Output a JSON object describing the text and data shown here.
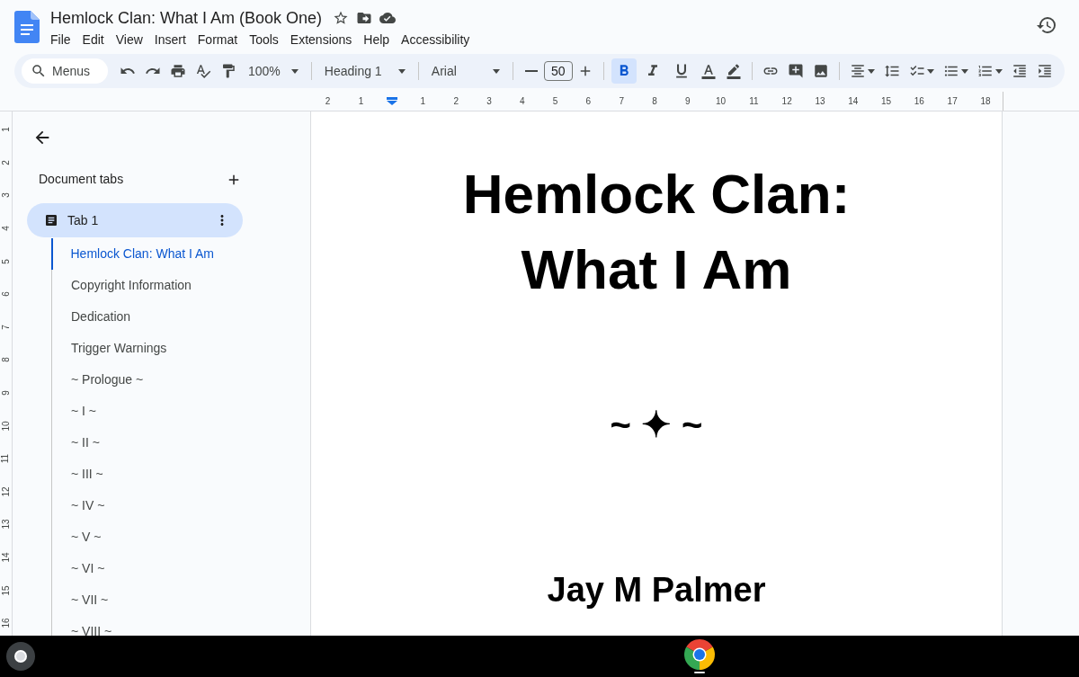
{
  "document": {
    "title": "Hemlock Clan: What I Am (Book One)"
  },
  "menu": [
    "File",
    "Edit",
    "View",
    "Insert",
    "Format",
    "Tools",
    "Extensions",
    "Help",
    "Accessibility"
  ],
  "toolbar": {
    "search_placeholder": "Menus",
    "zoom": "100%",
    "style": "Heading 1",
    "font": "Arial",
    "font_size": "50",
    "format_buttons": [
      {
        "kind": "bold",
        "selected": true
      },
      {
        "kind": "italic",
        "selected": false
      },
      {
        "kind": "underline",
        "selected": false
      }
    ]
  },
  "ruler": {
    "left_numbers": [
      "2",
      "1"
    ],
    "right_numbers": [
      "1",
      "2",
      "3",
      "4",
      "5",
      "6",
      "7",
      "8",
      "9",
      "10",
      "11",
      "12",
      "13",
      "14",
      "15",
      "16",
      "17",
      "18"
    ],
    "vertical_numbers": [
      "1",
      "2",
      "3",
      "4",
      "5",
      "6",
      "7",
      "8",
      "9",
      "10",
      "11",
      "12",
      "13",
      "14",
      "15",
      "16"
    ]
  },
  "sidebar": {
    "heading": "Document tabs",
    "tabs": [
      {
        "label": "Tab 1",
        "selected": true
      }
    ],
    "outline": [
      {
        "label": "Hemlock Clan: What I Am",
        "selected": true
      },
      {
        "label": "Copyright Information",
        "selected": false
      },
      {
        "label": "Dedication",
        "selected": false
      },
      {
        "label": "Trigger Warnings",
        "selected": false
      },
      {
        "label": "~ Prologue ~",
        "selected": false
      },
      {
        "label": "~ I ~",
        "selected": false
      },
      {
        "label": "~ II ~",
        "selected": false
      },
      {
        "label": "~ III ~",
        "selected": false
      },
      {
        "label": "~ IV ~",
        "selected": false
      },
      {
        "label": "~ V ~",
        "selected": false
      },
      {
        "label": "~ VI ~",
        "selected": false
      },
      {
        "label": "~ VII ~",
        "selected": false
      },
      {
        "label": "~ VIII ~",
        "selected": false
      }
    ]
  },
  "page": {
    "title_lines": [
      "Hemlock Clan:",
      "What I Am"
    ],
    "ornament": "~ ✦ ~",
    "author": "Jay M Palmer"
  }
}
